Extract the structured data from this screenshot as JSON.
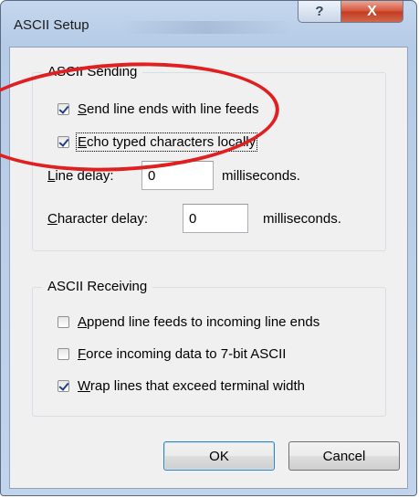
{
  "window": {
    "title": "ASCII Setup",
    "help_glyph": "?",
    "close_glyph": "X"
  },
  "sending": {
    "legend": "ASCII Sending",
    "send_line_ends": {
      "before": "",
      "key": "S",
      "after": "end line ends with line feeds",
      "checked": true
    },
    "echo_typed": {
      "before": "",
      "key": "E",
      "after": "cho typed characters locally",
      "checked": true
    },
    "line_delay": {
      "key": "L",
      "after": "ine delay:",
      "value": "0",
      "unit": "milliseconds."
    },
    "char_delay": {
      "key": "C",
      "after": "haracter delay:",
      "value": "0",
      "unit": "milliseconds."
    }
  },
  "receiving": {
    "legend": "ASCII Receiving",
    "append_lf": {
      "key": "A",
      "after": "ppend line feeds to incoming line ends",
      "checked": false
    },
    "force_7bit": {
      "key": "F",
      "after": "orce incoming data to 7-bit ASCII",
      "checked": false
    },
    "wrap_lines": {
      "key": "W",
      "after": "rap lines that exceed terminal width",
      "checked": true
    }
  },
  "buttons": {
    "ok": "OK",
    "cancel": "Cancel"
  },
  "colors": {
    "highlight": "#e02020",
    "close": "#c13d22",
    "checkmark": "#1f3f8a"
  }
}
